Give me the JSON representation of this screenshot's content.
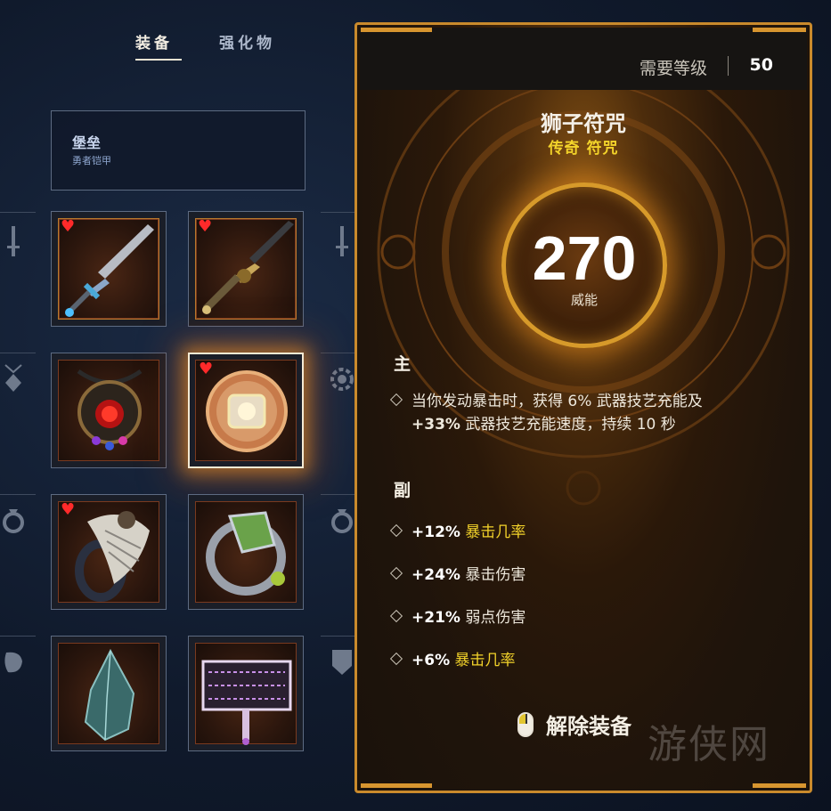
{
  "tabs": [
    {
      "label": "装备",
      "active": true
    },
    {
      "label": "强化物",
      "active": false
    }
  ],
  "build": {
    "name": "堡垒",
    "subtitle": "勇者铠甲"
  },
  "side_icons": {
    "left": [
      "sword-icon",
      "amulet-icon",
      "ring-icon",
      "offhand-icon"
    ],
    "right": [
      "sword-icon",
      "gear-icon",
      "ring-icon",
      "shield-icon"
    ]
  },
  "slots": [
    {
      "id": "weapon-1",
      "icon": "sword",
      "favorite": true
    },
    {
      "id": "weapon-2",
      "icon": "dagger",
      "favorite": true
    },
    {
      "id": "amulet",
      "icon": "amulet",
      "favorite": false
    },
    {
      "id": "charm",
      "icon": "charm",
      "favorite": true,
      "selected": true
    },
    {
      "id": "ring-1",
      "icon": "ring-feather",
      "favorite": true
    },
    {
      "id": "ring-2",
      "icon": "ring-gem",
      "favorite": false
    },
    {
      "id": "shard",
      "icon": "shard",
      "favorite": false
    },
    {
      "id": "hammer",
      "icon": "hammer",
      "favorite": false
    }
  ],
  "tooltip": {
    "required_level_label": "需要等级",
    "required_level": "50",
    "item_name": "狮子符咒",
    "rarity": "传奇 符咒",
    "power_value": "270",
    "power_label": "威能",
    "main_title": "主",
    "main_stat_line1": "当你发动暴击时，获得 6% 武器技艺充能及",
    "main_stat_line2_bold": "+33%",
    "main_stat_line2_rest": " 武器技艺充能速度，持续 10 秒",
    "sub_title": "副",
    "sub_stats": [
      {
        "value": "+12%",
        "label": "暴击几率",
        "highlight": true
      },
      {
        "value": "+24%",
        "label": "暴击伤害",
        "highlight": false
      },
      {
        "value": "+21%",
        "label": "弱点伤害",
        "highlight": false
      },
      {
        "value": "+6%",
        "label": "暴击几率",
        "highlight": true
      }
    ],
    "unequip_label": "解除装备"
  },
  "colors": {
    "accent_gold": "#d7952f",
    "highlight_yellow": "#f2d22a",
    "favorite_red": "#ff2a2a"
  },
  "watermark": "游侠网"
}
